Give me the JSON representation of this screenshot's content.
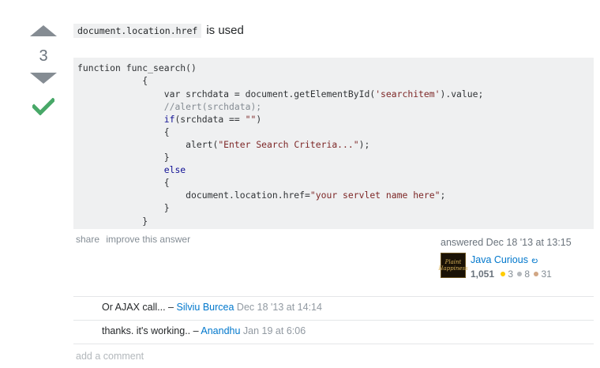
{
  "vote": {
    "count": "3"
  },
  "answer": {
    "intro_code": "document.location.href",
    "intro_text": "is used",
    "code_lines": [
      [
        {
          "t": "function func_search()",
          "c": ""
        }
      ],
      [
        {
          "t": "            {",
          "c": ""
        }
      ],
      [
        {
          "t": "                var srchdata = document.getElementById(",
          "c": ""
        },
        {
          "t": "'searchitem'",
          "c": "str"
        },
        {
          "t": ").value;",
          "c": ""
        }
      ],
      [
        {
          "t": "                //alert(srchdata);",
          "c": "com"
        }
      ],
      [
        {
          "t": "                ",
          "c": ""
        },
        {
          "t": "if",
          "c": "kw"
        },
        {
          "t": "(srchdata == ",
          "c": ""
        },
        {
          "t": "\"\"",
          "c": "str"
        },
        {
          "t": ")",
          "c": ""
        }
      ],
      [
        {
          "t": "                {",
          "c": ""
        }
      ],
      [
        {
          "t": "                    alert(",
          "c": ""
        },
        {
          "t": "\"Enter Search Criteria...\"",
          "c": "str"
        },
        {
          "t": ");",
          "c": ""
        }
      ],
      [
        {
          "t": "                }",
          "c": ""
        }
      ],
      [
        {
          "t": "                ",
          "c": ""
        },
        {
          "t": "else",
          "c": "kw"
        }
      ],
      [
        {
          "t": "                {",
          "c": ""
        }
      ],
      [
        {
          "t": "                    document.location.href=",
          "c": ""
        },
        {
          "t": "\"your servlet name here\"",
          "c": "str"
        },
        {
          "t": ";",
          "c": ""
        }
      ],
      [
        {
          "t": "                }",
          "c": ""
        }
      ],
      [
        {
          "t": "            }",
          "c": ""
        }
      ]
    ]
  },
  "post_menu": {
    "share": "share",
    "improve": "improve this answer"
  },
  "user_info": {
    "action_time": "answered Dec 18 '13 at 13:15",
    "avatar_text": "Plaint Happiness",
    "name": "Java Curious",
    "name_ext": "ల",
    "reputation": "1,051",
    "gold": "3",
    "silver": "8",
    "bronze": "31"
  },
  "comments": [
    {
      "text": "Or AJAX call... – ",
      "user": "Silviu Burcea",
      "date": "Dec 18 '13 at 14:14"
    },
    {
      "text": "thanks. it's working.. – ",
      "user": "Anandhu",
      "date": "Jan 19 at 6:06"
    }
  ],
  "add_comment": "add a comment",
  "colors": {
    "link": "#0077cc",
    "accepted": "#48a868",
    "code_bg": "#eff0f1"
  }
}
